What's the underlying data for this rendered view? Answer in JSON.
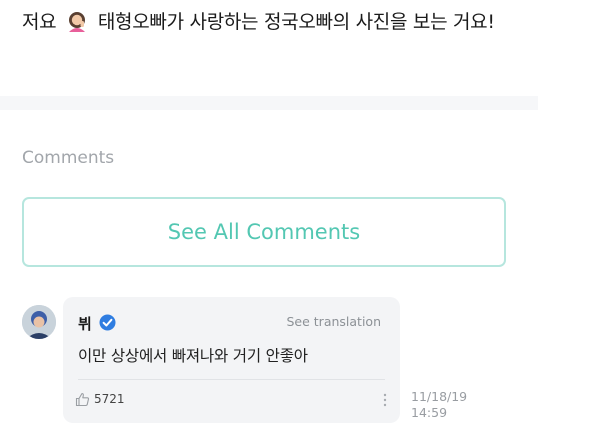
{
  "post": {
    "text_before_emoji": "저요",
    "text_after_emoji": "태형오빠가 사랑하는 정국오빠의 사진을 보는 거요!",
    "emoji_icon": "woman-tipping-hand-icon"
  },
  "comments_section": {
    "heading": "Comments",
    "see_all_label": "See All Comments"
  },
  "comment": {
    "author": "뷔",
    "verified_icon": "verified-badge-icon",
    "translate_label": "See translation",
    "body": "이만 상상에서 빠져나와 거기 안좋아",
    "like_icon": "thumbs-up-icon",
    "likes": "5721",
    "date": "11/18/19",
    "time": "14:59"
  },
  "colors": {
    "accent": "#53c7b2",
    "accent_border": "#b6e6de",
    "verified": "#2f7de1"
  }
}
